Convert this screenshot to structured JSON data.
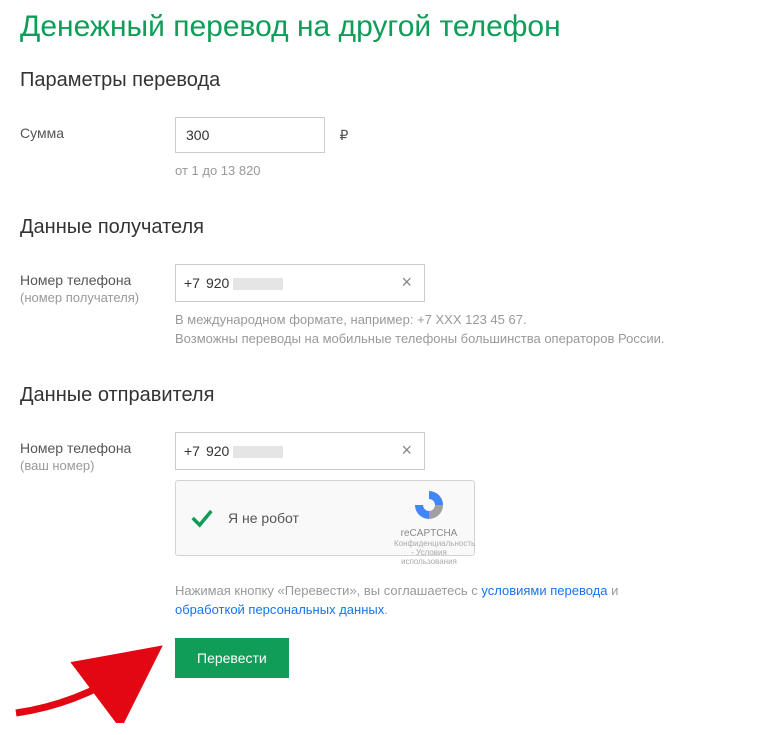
{
  "page": {
    "title": "Денежный перевод на другой телефон"
  },
  "sections": {
    "params": "Параметры перевода",
    "recipient": "Данные получателя",
    "sender": "Данные отправителя"
  },
  "amount": {
    "label": "Сумма",
    "value": "300",
    "currency": "₽",
    "hint": "от 1 до 13 820"
  },
  "recipient": {
    "label": "Номер телефона",
    "sublabel": "(номер получателя)",
    "prefix": "+7",
    "value": "920",
    "hint": "В международном формате, например: +7 XXX 123 45 67.\nВозможны переводы на мобильные телефоны большинства операторов России."
  },
  "sender": {
    "label": "Номер телефона",
    "sublabel": "(ваш номер)",
    "prefix": "+7",
    "value": "920"
  },
  "recaptcha": {
    "label": "Я не робот",
    "brand": "reCAPTCHA",
    "terms": "Конфиденциальность - Условия использования"
  },
  "consent": {
    "prefix": "Нажимая кнопку «Перевести», вы соглашаетесь с ",
    "link1": "условиями перевода",
    "middle": " и ",
    "link2": "обработкой персональных данных",
    "suffix": "."
  },
  "submit": {
    "label": "Перевести"
  }
}
